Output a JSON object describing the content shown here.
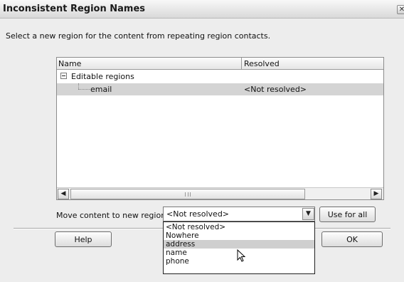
{
  "dialog": {
    "title": "Inconsistent Region Names",
    "close_glyph": "x",
    "instruction": "Select a new region for the content from repeating region contacts."
  },
  "tree": {
    "columns": [
      "Name",
      "Resolved"
    ],
    "group": {
      "expand_glyph": "minus",
      "label": "Editable regions"
    },
    "rows": [
      {
        "name": "email",
        "resolved": "<Not resolved>",
        "selected": true
      }
    ],
    "scrollbar": {
      "left_arrow": "<",
      "right_arrow": ">",
      "grip": "III"
    }
  },
  "move": {
    "label": "Move content to new region:",
    "current_value": "<Not resolved>",
    "options": [
      "<Not resolved>",
      "Nowhere",
      "address",
      "name",
      "phone"
    ],
    "highlighted_option": "address"
  },
  "buttons": {
    "use_for_all": "Use for all",
    "help": "Help",
    "ok": "OK"
  },
  "icons": {
    "dropdown_arrow": "chevron-down-icon",
    "cursor": "pointer-cursor-icon"
  },
  "colors": {
    "selection": "#d4d4d4",
    "dialog_bg": "#ededed"
  }
}
